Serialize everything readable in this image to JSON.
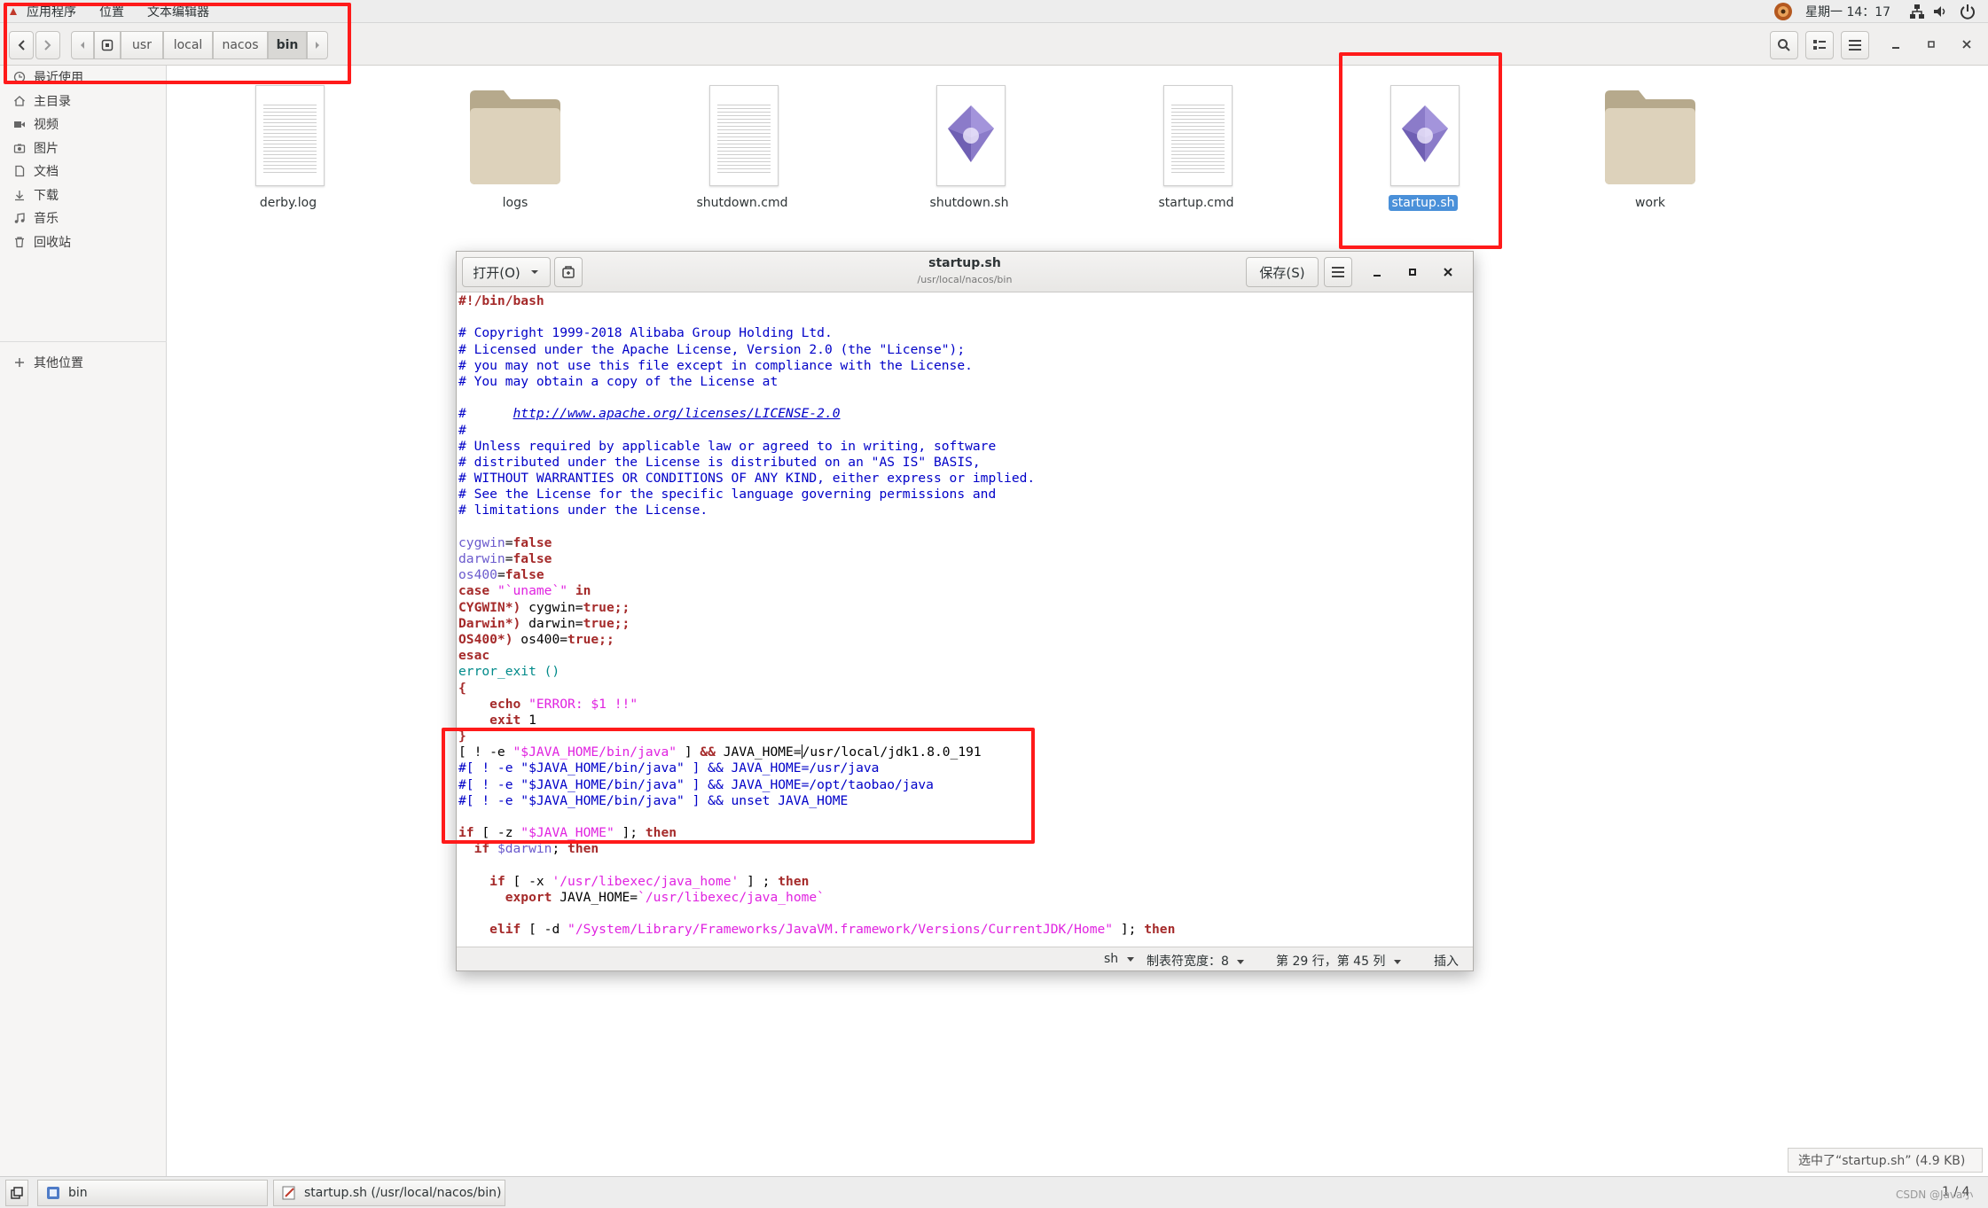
{
  "topbar": {
    "menu_apps": "应用程序",
    "menu_places": "位置",
    "menu_app": "文本编辑器",
    "clock": "星期一 14：17"
  },
  "headerbar": {
    "breadcrumbs": [
      "usr",
      "local",
      "nacos",
      "bin"
    ]
  },
  "sidebar": {
    "items": [
      {
        "label": "最近使用",
        "icon": "clock-icon"
      },
      {
        "label": "主目录",
        "icon": "home-icon"
      },
      {
        "label": "视频",
        "icon": "video-icon"
      },
      {
        "label": "图片",
        "icon": "camera-icon"
      },
      {
        "label": "文档",
        "icon": "document-icon"
      },
      {
        "label": "下载",
        "icon": "download-icon"
      },
      {
        "label": "音乐",
        "icon": "music-icon"
      },
      {
        "label": "回收站",
        "icon": "trash-icon"
      }
    ],
    "other_locations": "其他位置"
  },
  "files": [
    {
      "name": "derby.log",
      "type": "text"
    },
    {
      "name": "logs",
      "type": "folder"
    },
    {
      "name": "shutdown.cmd",
      "type": "text"
    },
    {
      "name": "shutdown.sh",
      "type": "script"
    },
    {
      "name": "startup.cmd",
      "type": "text"
    },
    {
      "name": "startup.sh",
      "type": "script",
      "selected": true
    },
    {
      "name": "work",
      "type": "folder"
    }
  ],
  "editor": {
    "open_label": "打开(O)",
    "save_label": "保存(S)",
    "title": "startup.sh",
    "subtitle": "/usr/local/nacos/bin",
    "status": {
      "language": "sh",
      "tab_width": "制表符宽度：8",
      "position": "第 29 行，第 45 列",
      "mode": "插入"
    }
  },
  "code_lines": [
    [
      [
        "kw",
        "#!/bin/bash"
      ]
    ],
    [],
    [
      [
        "c",
        "# Copyright 1999-2018 Alibaba Group Holding Ltd."
      ]
    ],
    [
      [
        "c",
        "# Licensed under the Apache License, Version 2.0 (the \"License\");"
      ]
    ],
    [
      [
        "c",
        "# you may not use this file except in compliance with the License."
      ]
    ],
    [
      [
        "c",
        "# You may obtain a copy of the License at"
      ]
    ],
    [],
    [
      [
        "c",
        "#      "
      ],
      [
        "url",
        "http://www.apache.org/licenses/LICENSE-2.0"
      ]
    ],
    [
      [
        "c",
        "#"
      ]
    ],
    [
      [
        "c",
        "# Unless required by applicable law or agreed to in writing, software"
      ]
    ],
    [
      [
        "c",
        "# distributed under the License is distributed on an \"AS IS\" BASIS,"
      ]
    ],
    [
      [
        "c",
        "# WITHOUT WARRANTIES OR CONDITIONS OF ANY KIND, either express or implied."
      ]
    ],
    [
      [
        "c",
        "# See the License for the specific language governing permissions and"
      ]
    ],
    [
      [
        "c",
        "# limitations under the License."
      ]
    ],
    [],
    [
      [
        "vr",
        "cygwin"
      ],
      [
        "nr",
        "="
      ],
      [
        "kw",
        "false"
      ]
    ],
    [
      [
        "vr",
        "darwin"
      ],
      [
        "nr",
        "="
      ],
      [
        "kw",
        "false"
      ]
    ],
    [
      [
        "vr",
        "os400"
      ],
      [
        "nr",
        "="
      ],
      [
        "kw",
        "false"
      ]
    ],
    [
      [
        "kw",
        "case"
      ],
      [
        "nr",
        " "
      ],
      [
        "st",
        "\"`uname`\""
      ],
      [
        "nr",
        " "
      ],
      [
        "kw",
        "in"
      ]
    ],
    [
      [
        "kw",
        "CYGWIN*)"
      ],
      [
        "nr",
        " cygwin="
      ],
      [
        "kw",
        "true;;"
      ]
    ],
    [
      [
        "kw",
        "Darwin*)"
      ],
      [
        "nr",
        " darwin="
      ],
      [
        "kw",
        "true;;"
      ]
    ],
    [
      [
        "kw",
        "OS400*)"
      ],
      [
        "nr",
        " os400="
      ],
      [
        "kw",
        "true;;"
      ]
    ],
    [
      [
        "kw",
        "esac"
      ]
    ],
    [
      [
        "fn",
        "error_exit ()"
      ]
    ],
    [
      [
        "kw",
        "{"
      ]
    ],
    [
      [
        "nr",
        "    "
      ],
      [
        "kw",
        "echo"
      ],
      [
        "nr",
        " "
      ],
      [
        "st",
        "\"ERROR: $1 !!\""
      ]
    ],
    [
      [
        "nr",
        "    "
      ],
      [
        "kw",
        "exit"
      ],
      [
        "nr",
        " 1"
      ]
    ],
    [
      [
        "kw",
        "}"
      ]
    ],
    [
      [
        "nr",
        "[ ! -e "
      ],
      [
        "st",
        "\"$JAVA_HOME/bin/java\""
      ],
      [
        "nr",
        " ] "
      ],
      [
        "kw",
        "&&"
      ],
      [
        "nr",
        " JAVA_HOME="
      ],
      [
        "cursor",
        ""
      ],
      [
        "nr",
        "/usr/local/jdk1.8.0_191"
      ]
    ],
    [
      [
        "c",
        "#[ ! -e \"$JAVA_HOME/bin/java\" ] && JAVA_HOME=/usr/java"
      ]
    ],
    [
      [
        "c",
        "#[ ! -e \"$JAVA_HOME/bin/java\" ] && JAVA_HOME=/opt/taobao/java"
      ]
    ],
    [
      [
        "c",
        "#[ ! -e \"$JAVA_HOME/bin/java\" ] && unset JAVA_HOME"
      ]
    ],
    [],
    [
      [
        "kw",
        "if"
      ],
      [
        "nr",
        " [ -z "
      ],
      [
        "st",
        "\"$JAVA_HOME\""
      ],
      [
        "nr",
        " ]; "
      ],
      [
        "kw",
        "then"
      ]
    ],
    [
      [
        "nr",
        "  "
      ],
      [
        "kw",
        "if"
      ],
      [
        "nr",
        " "
      ],
      [
        "vr",
        "$darwin"
      ],
      [
        "nr",
        "; "
      ],
      [
        "kw",
        "then"
      ]
    ],
    [],
    [
      [
        "nr",
        "    "
      ],
      [
        "kw",
        "if"
      ],
      [
        "nr",
        " [ -x "
      ],
      [
        "st",
        "'/usr/libexec/java_home'"
      ],
      [
        "nr",
        " ] ; "
      ],
      [
        "kw",
        "then"
      ]
    ],
    [
      [
        "nr",
        "      "
      ],
      [
        "kw",
        "export"
      ],
      [
        "nr",
        " JAVA_HOME="
      ],
      [
        "st",
        "`/usr/libexec/java_home`"
      ]
    ],
    [],
    [
      [
        "nr",
        "    "
      ],
      [
        "kw",
        "elif"
      ],
      [
        "nr",
        " [ -d "
      ],
      [
        "st",
        "\"/System/Library/Frameworks/JavaVM.framework/Versions/CurrentJDK/Home\""
      ],
      [
        "nr",
        " ]; "
      ],
      [
        "kw",
        "then"
      ]
    ]
  ],
  "selection_info": "选中了“startup.sh” (4.9 KB)",
  "taskbar": {
    "task1": "bin",
    "task2": "startup.sh (/usr/local/nacos/bin) - g...",
    "pager": "1 / 4",
    "watermark": "CSDN @Java小"
  }
}
